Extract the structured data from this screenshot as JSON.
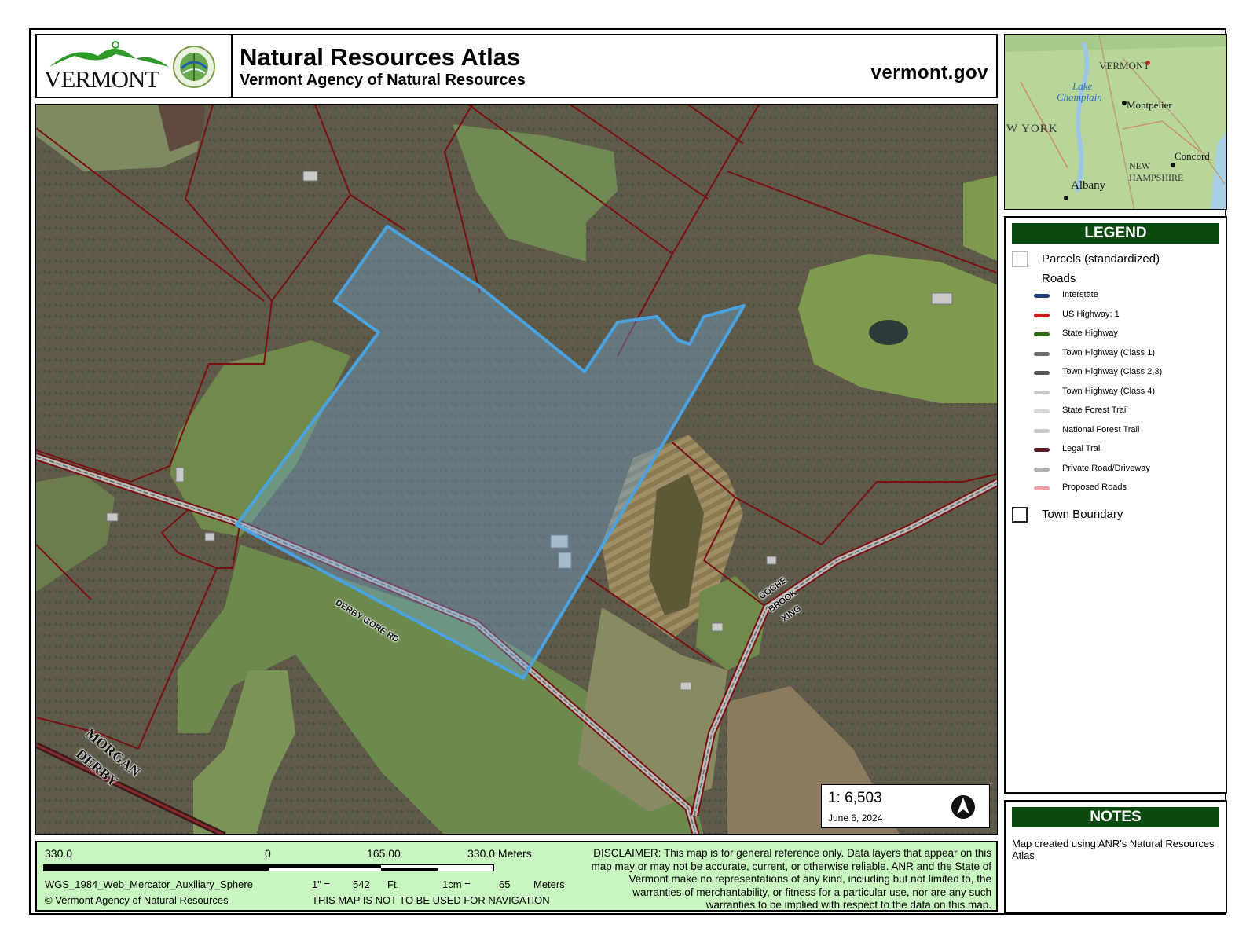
{
  "header": {
    "logo_text": "VERMONT",
    "title": "Natural Resources Atlas",
    "subtitle": "Vermont Agency of Natural Resources",
    "site": "vermont.gov"
  },
  "inset": {
    "labels": {
      "vermont": "VERMONT",
      "lake": "Lake",
      "champlain": "Champlain",
      "montpelier": "Montpelier",
      "new_york": "W YORK",
      "new": "NEW",
      "hampshire": "HAMPSHIRE",
      "concord": "Concord",
      "albany": "Albany"
    }
  },
  "legend": {
    "title": "LEGEND",
    "parcels": "Parcels (standardized)",
    "roads": "Roads",
    "road_items": [
      {
        "label": "Interstate",
        "color": "#1f3f7a"
      },
      {
        "label": "US Highway; 1",
        "color": "#c81e1e"
      },
      {
        "label": "State Highway",
        "color": "#2e6b14"
      },
      {
        "label": "Town Highway (Class 1)",
        "color": "#6c6c6c"
      },
      {
        "label": "Town Highway (Class 2,3)",
        "color": "#555555"
      },
      {
        "label": "Town Highway (Class 4)",
        "color": "#c8c8c8"
      },
      {
        "label": "State Forest Trail",
        "color": "#d8d8d8"
      },
      {
        "label": "National Forest Trail",
        "color": "#cccccc"
      },
      {
        "label": "Legal Trail",
        "color": "#5a1a24"
      },
      {
        "label": "Private Road/Driveway",
        "color": "#b0b0b0"
      },
      {
        "label": "Proposed Roads",
        "color": "#f0a0a0"
      }
    ],
    "town_boundary": "Town Boundary"
  },
  "notes": {
    "title": "NOTES",
    "text": "Map created using ANR's Natural Resources Atlas"
  },
  "map": {
    "scale": "1:  6,503",
    "date": "June 6, 2024",
    "road_labels": {
      "derby_gore": "DERBY GORE RD",
      "coche1": "COCHE",
      "coche2": "BROOK",
      "coche3": "XING",
      "town1": "MORGAN",
      "town2": "DERBY"
    }
  },
  "scalebar": {
    "left": "330.0",
    "zero": "0",
    "mid": "165.00",
    "right": "330.0 Meters",
    "projection": "WGS_1984_Web_Mercator_Auxiliary_Sphere",
    "inch_eq": "1\" =",
    "inch_val": "542",
    "inch_unit": "Ft.",
    "cm_eq": "1cm =",
    "cm_val": "65",
    "cm_unit": "Meters",
    "copyright": "© Vermont Agency of Natural Resources",
    "navigation": "THIS MAP IS NOT TO BE USED FOR NAVIGATION",
    "disclaimer": "DISCLAIMER: This map is for general reference only. Data layers that appear on this map may or may not be accurate, current, or otherwise reliable. ANR and the State of Vermont make no representations of any kind, including but not limited to, the warranties of merchantability, or fitness for a particular use, nor are any such warranties to be implied with respect to the data on this map."
  },
  "colors": {
    "parcel_line": "#7a0f12",
    "subject_parcel": "#4aa3e0",
    "panel_green": "#0b4a0e",
    "scale_bg": "#c9f5c0"
  }
}
